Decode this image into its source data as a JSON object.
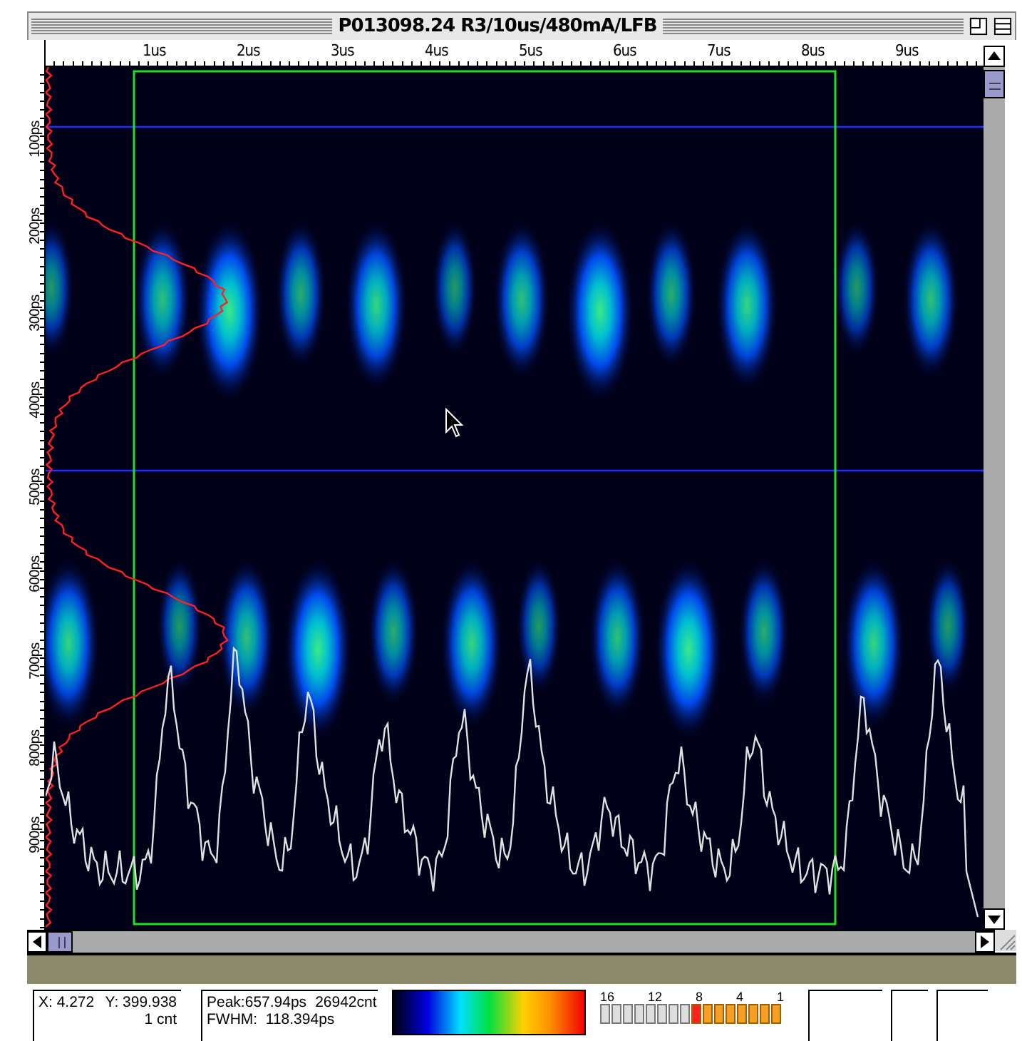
{
  "window": {
    "title": "P013098.24 R3/10us/480mA/LFB"
  },
  "x_ruler": {
    "labels": [
      "1us",
      "2us",
      "3us",
      "4us",
      "5us",
      "6us",
      "7us",
      "8us",
      "9us"
    ]
  },
  "y_ruler": {
    "labels": [
      "100ps",
      "200ps",
      "300ps",
      "400ps",
      "500ps",
      "600ps",
      "700ps",
      "800ps",
      "900ps"
    ]
  },
  "status": {
    "x": "X: 4.272",
    "y": "Y: 399.938",
    "count": "1 cnt",
    "peak": "Peak:657.94ps",
    "peak_count": "26942cnt",
    "fwhm": "FWHM:  118.394ps"
  },
  "lut_scale": {
    "labels": [
      "16",
      "12",
      "8",
      "4",
      "1"
    ],
    "cells": [
      {
        "active": false,
        "selected": false
      },
      {
        "active": false,
        "selected": false
      },
      {
        "active": false,
        "selected": false
      },
      {
        "active": false,
        "selected": false
      },
      {
        "active": false,
        "selected": false
      },
      {
        "active": false,
        "selected": false
      },
      {
        "active": false,
        "selected": false
      },
      {
        "active": false,
        "selected": false
      },
      {
        "active": true,
        "selected": true
      },
      {
        "active": true,
        "selected": false
      },
      {
        "active": true,
        "selected": false
      },
      {
        "active": true,
        "selected": false
      },
      {
        "active": true,
        "selected": false
      },
      {
        "active": true,
        "selected": false
      },
      {
        "active": true,
        "selected": false
      },
      {
        "active": true,
        "selected": false
      }
    ]
  }
}
